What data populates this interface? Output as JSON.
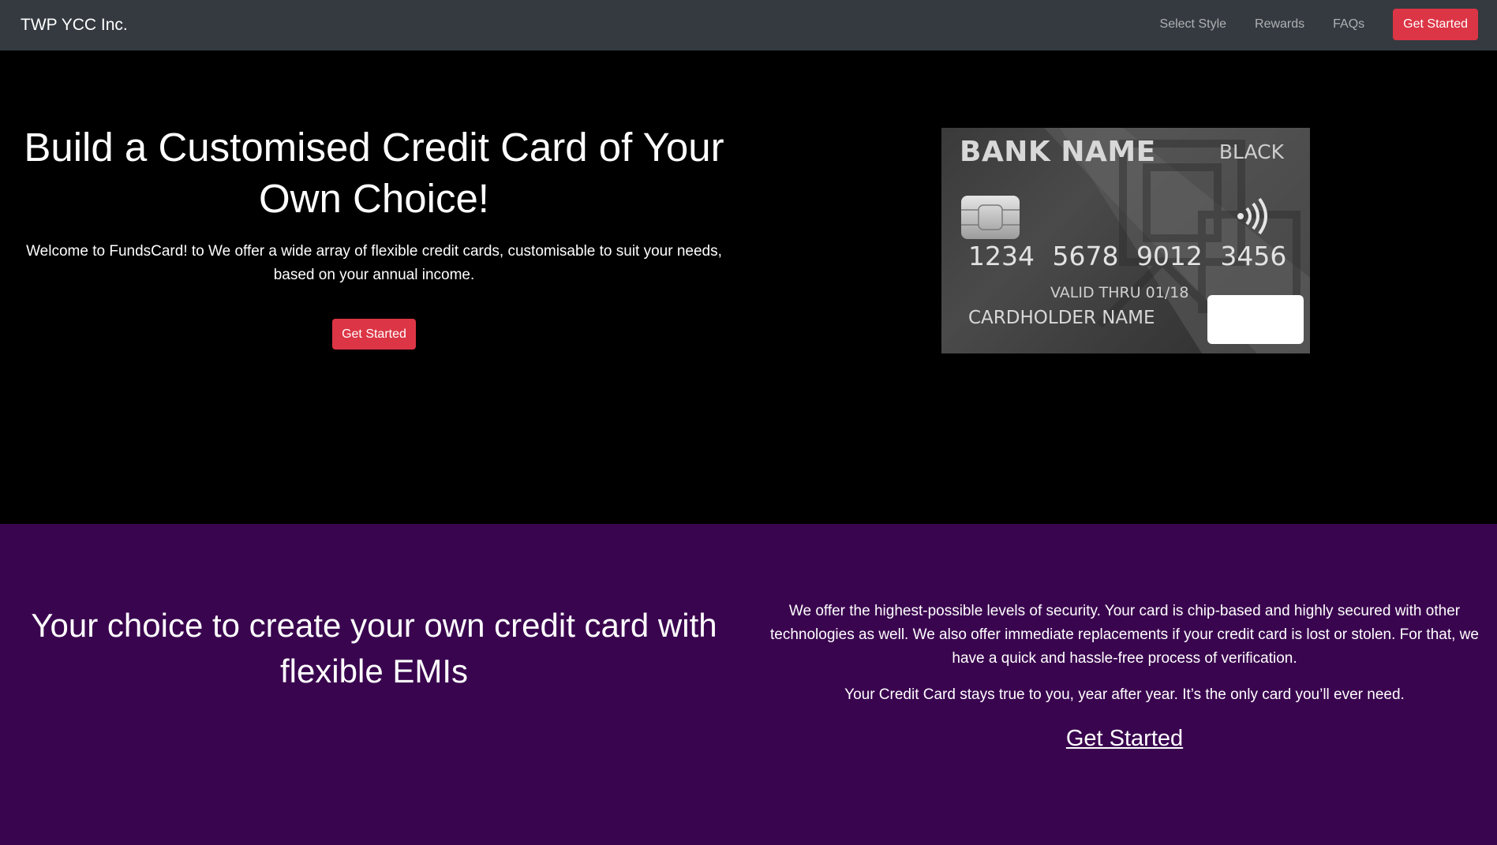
{
  "navbar": {
    "brand": "TWP YCC Inc.",
    "links": [
      "Select Style",
      "Rewards",
      "FAQs"
    ],
    "cta_label": "Get Started"
  },
  "hero": {
    "title": "Build a Customised Credit Card of Your Own Choice!",
    "text": "Welcome to FundsCard! to We offer a wide array of flexible credit cards, customisable to suit your needs, based on your annual income.",
    "cta_label": "Get Started",
    "card": {
      "bank_name": "BANK NAME",
      "tier": "BLACK",
      "number": "1234 5678 9012 3456",
      "valid_thru": "VALID THRU 01/18",
      "holder": "CARDHOLDER NAME"
    }
  },
  "section2": {
    "title": "Your choice to create your own credit card with flexible EMIs",
    "paragraph1": "We offer the highest-possible levels of security. Your card is chip-based and highly secured with other technologies as well. We also offer immediate replacements if your credit card is lost or stolen. For that, we have a quick and hassle-free process of verification.",
    "paragraph2": "Your Credit Card stays true to you, year after year. It’s the only card you’ll ever need.",
    "cta_label": "Get Started"
  },
  "colors": {
    "navbar_bg": "#343a40",
    "accent_red": "#dc3545",
    "hero_bg": "#000000",
    "section2_bg": "#3a054f"
  }
}
